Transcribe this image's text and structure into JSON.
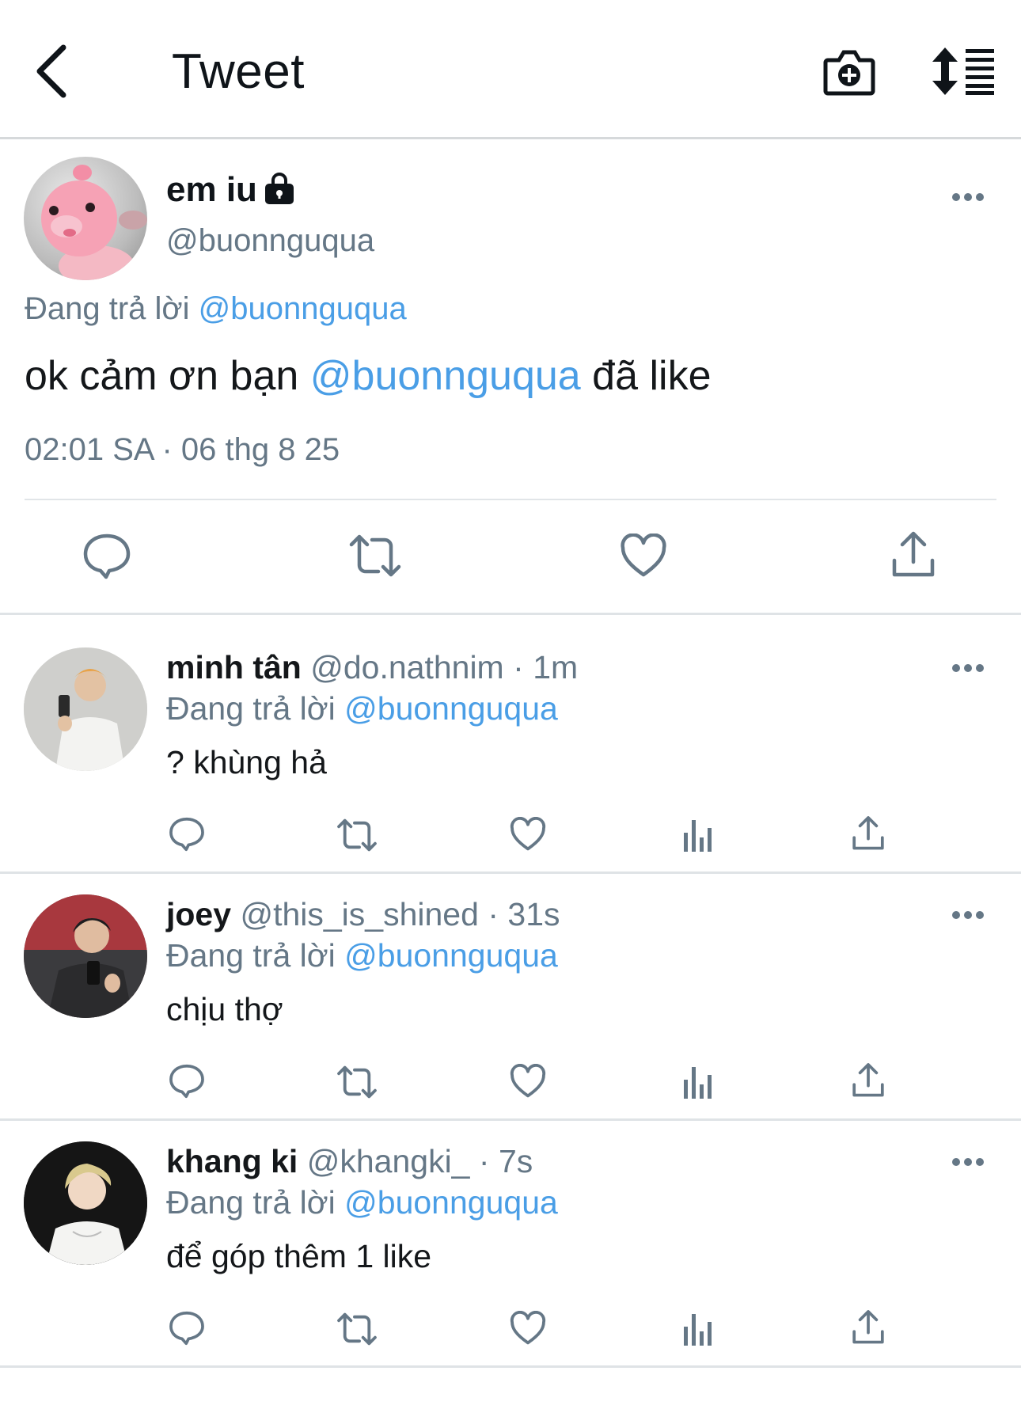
{
  "header": {
    "title": "Tweet",
    "back_icon": "chevron-left-icon",
    "camera_icon": "camera-plus-icon",
    "sort_icon": "sort-list-icon"
  },
  "main_tweet": {
    "name": "em iu",
    "handle": "@buonnguqua",
    "replying_prefix": "Đang trả lời",
    "replying_to": "@buonnguqua",
    "text_before": "ok cảm ơn bạn ",
    "text_mention": "@buonnguqua",
    "text_after": " đã like",
    "timestamp": "02:01 SA · 06 thg 8 25",
    "locked": true
  },
  "replies": [
    {
      "name": "minh tân",
      "handle": "@do.nathnim",
      "time": "1m",
      "replying_prefix": "Đang trả lời",
      "replying_to": "@buonnguqua",
      "text": "? khùng hả"
    },
    {
      "name": "joey",
      "handle": "@this_is_shined",
      "time": "31s",
      "replying_prefix": "Đang trả lời",
      "replying_to": "@buonnguqua",
      "text": "chịu thợ"
    },
    {
      "name": "khang ki",
      "handle": "@khangki_",
      "time": "7s",
      "replying_prefix": "Đang trả lời",
      "replying_to": "@buonnguqua",
      "text": "để góp thêm 1 like"
    }
  ],
  "colors": {
    "accent": "#4a9ee6",
    "secondary_text": "#657786",
    "primary_text": "#14171a",
    "divider": "#dfe3e6"
  }
}
